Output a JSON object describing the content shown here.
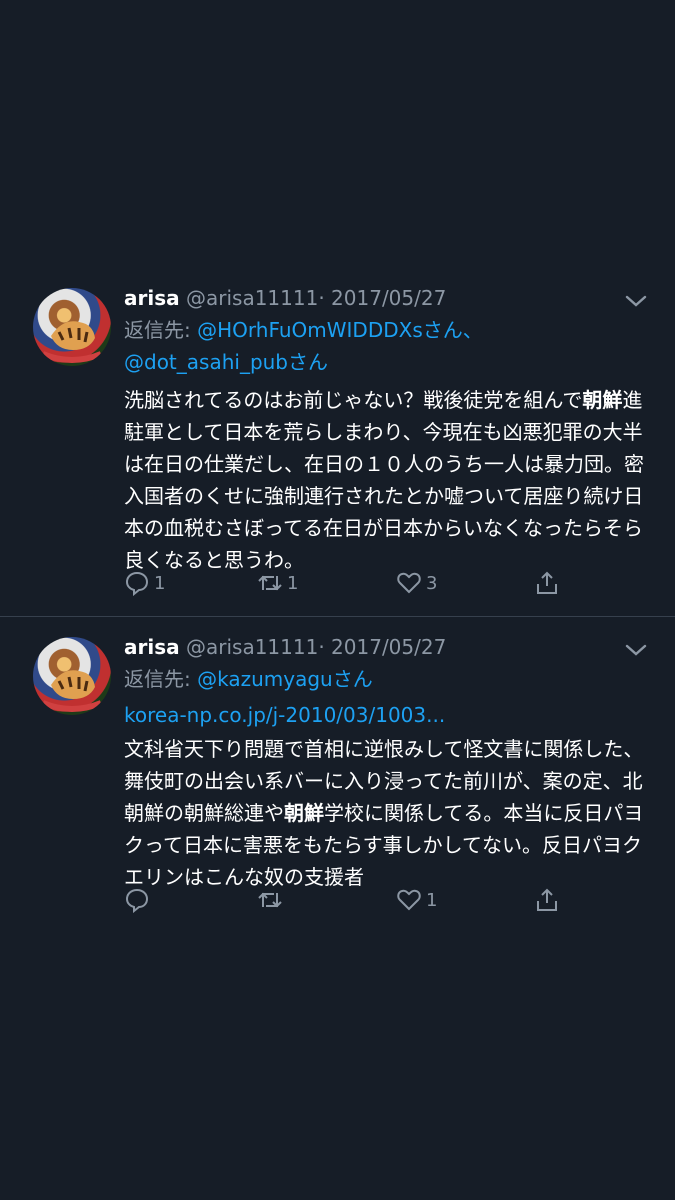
{
  "tweets": [
    {
      "name": "arisa",
      "handle": "@arisa11111",
      "date": "· 2017/05/27",
      "reply_prefix": "返信先:",
      "reply_mentions": [
        "@HOrhFuOmWIDDDXsさん、",
        "@dot_asahi_pubさん"
      ],
      "body": [
        {
          "t": "洗脳されてるのはお前じゃない？戦後徒党を組んで"
        },
        {
          "t": "朝鮮",
          "b": true
        },
        {
          "t": "進駐軍として日本を荒らしまわり、今現在も凶悪犯罪の大半は在日の仕業だし、在日の１０人のうち一人は暴力団。密入国者のくせに強制連行されたとか嘘ついて居座り続け日本の血税むさぼってる在日が日本からいなくなったらそら良くなると思うわ。"
        }
      ],
      "counts": {
        "reply": "1",
        "retweet": "1",
        "like": "3"
      }
    },
    {
      "name": "arisa",
      "handle": "@arisa11111",
      "date": "· 2017/05/27",
      "reply_prefix": "返信先:",
      "reply_mentions": [
        "@kazumyaguさん"
      ],
      "link": "korea-np.co.jp/j-2010/03/1003...",
      "body": [
        {
          "t": "文科省天下り問題で首相に逆恨みして怪文書に関係した、舞伎町の出会い系バーに入り浸ってた前川が、案の定、北朝鮮の朝鮮総連や"
        },
        {
          "t": "朝鮮",
          "b": true
        },
        {
          "t": "学校に関係してる。本当に反日パヨクって日本に害悪をもたらす事しかしてない。反日パヨクエリンはこんな奴の支援者"
        }
      ],
      "counts": {
        "reply": "",
        "retweet": "",
        "like": "1"
      }
    }
  ],
  "colors": {
    "background": "#161d27",
    "accent": "#1da1f2",
    "muted": "#8c97a4",
    "divider": "#36404d"
  },
  "icons": {
    "menu": "chevron-down-icon",
    "reply": "reply-icon",
    "retweet": "retweet-icon",
    "like": "heart-icon",
    "share": "share-icon"
  }
}
